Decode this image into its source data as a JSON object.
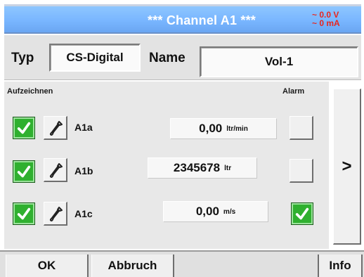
{
  "header": {
    "title": "***  Channel A1  ***",
    "status_voltage": "~ 0.0 V",
    "status_current": "~ 0 mA"
  },
  "config": {
    "typ_label": "Typ",
    "typ_value": "CS-Digital",
    "name_label": "Name",
    "name_value": "Vol-1"
  },
  "panel": {
    "record_label": "Aufzeichnen",
    "alarm_label": "Alarm",
    "channels": [
      {
        "label": "A1a",
        "value": "0,00",
        "unit": "ltr/min",
        "recording": true,
        "alarm": false
      },
      {
        "label": "A1b",
        "value": "2345678",
        "unit": "ltr",
        "recording": true,
        "alarm": false
      },
      {
        "label": "A1c",
        "value": "0,00",
        "unit": "m/s",
        "recording": true,
        "alarm": true
      }
    ]
  },
  "next_button_label": ">",
  "footer": {
    "ok_label": "OK",
    "cancel_label": "Abbruch",
    "info_label": "Info"
  },
  "colors": {
    "titlebar": "#79b6ff",
    "status_text": "#e8261e",
    "checkbox_on": "#2fb02f"
  }
}
